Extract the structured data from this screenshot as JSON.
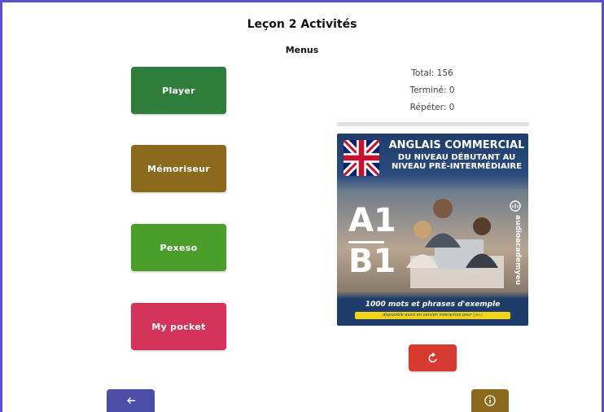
{
  "header": {
    "title": "Leçon 2 Activités",
    "subtitle": "Menus"
  },
  "menu": {
    "items": [
      {
        "label": "Player",
        "color": "#2f7d3a"
      },
      {
        "label": "Mémoriseur",
        "color": "#8b6a1e"
      },
      {
        "label": "Pexeso",
        "color": "#4a9e2a"
      },
      {
        "label": "My pocket",
        "color": "#d4345a"
      }
    ]
  },
  "stats": {
    "total": "Total: 156",
    "done": "Terminé: 0",
    "repeat": "Répéter: 0",
    "progress": 0
  },
  "cover": {
    "title": "ANGLAIS COMMERCIAL",
    "line2": "DU NIVEAU DÉBUTANT AU",
    "line3": "NIVEAU PRÉ-INTERMÉDIAIRE",
    "level_top": "A1",
    "level_bottom": "B1",
    "brand": "audioacademyeu",
    "tagline": "1000 mots et phrases d'exemple",
    "note": "disponible aussi en version interactive pour"
  },
  "icons": {
    "reset": "reset-icon",
    "back": "arrow-left-icon",
    "info": "info-icon"
  },
  "colors": {
    "frame": "#5a4fcf",
    "reset": "#d93a30",
    "back": "#4a4ea6",
    "info": "#8b6a1e"
  }
}
